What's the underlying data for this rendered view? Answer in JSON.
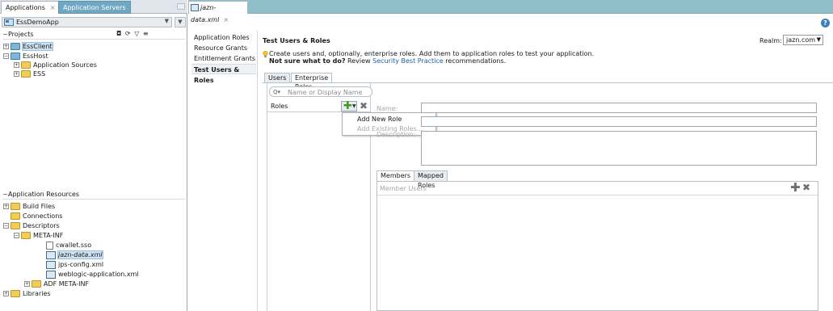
{
  "left_panel": {
    "tabs": [
      {
        "label": "Applications",
        "active": true
      },
      {
        "label": "Application Servers",
        "active": false
      }
    ],
    "app_selector": {
      "value": "EssDemoApp"
    },
    "projects": {
      "header": "Projects",
      "toolbar_icons": [
        "filter-icon",
        "sync-icon",
        "funnel-icon",
        "menu-icon"
      ],
      "items": [
        {
          "label": "EssClient",
          "level": 0,
          "expanded": false,
          "selected": true
        },
        {
          "label": "EssHost",
          "level": 0,
          "expanded": true,
          "selected": false
        },
        {
          "label": "Application Sources",
          "level": 1,
          "expanded": false,
          "selected": false
        },
        {
          "label": "ESS",
          "level": 1,
          "expanded": false,
          "selected": false
        }
      ]
    },
    "resources": {
      "header": "Application Resources",
      "items": [
        {
          "label": "Build Files",
          "level": 0
        },
        {
          "label": "Connections",
          "level": 0
        },
        {
          "label": "Descriptors",
          "level": 0
        },
        {
          "label": "META-INF",
          "level": 1
        },
        {
          "label": "cwallet.sso",
          "level": 2
        },
        {
          "label": "jazn-data.xml",
          "level": 2
        },
        {
          "label": "jps-config.xml",
          "level": 2
        },
        {
          "label": "weblogic-application.xml",
          "level": 2
        },
        {
          "label": "ADF META-INF",
          "level": 1
        },
        {
          "label": "Libraries",
          "level": 0
        }
      ]
    }
  },
  "editor": {
    "tab_label": "jazn-data.xml",
    "nav": {
      "items": [
        "Application Roles",
        "Resource Grants",
        "Entitlement Grants",
        "Test Users & Roles"
      ],
      "active_index": 3
    },
    "title": "Test Users & Roles",
    "realm_label": "Realm:",
    "realm_value": "jazn.com",
    "description": "Create users and, optionally, enterprise roles. Add them to application roles to test your application.",
    "hint_bold": "Not sure what to do?",
    "hint_text": "Review",
    "hint_link": "Security Best Practice",
    "hint_suffix": "recommendations.",
    "subtabs": [
      {
        "label": "Users",
        "active": false
      },
      {
        "label": "Enterprise Roles",
        "active": true
      }
    ],
    "search_placeholder": "Name or Display Name",
    "roles_header": "Roles",
    "add_menu": {
      "items": [
        {
          "label": "Add New Role",
          "enabled": true
        },
        {
          "label": "Add Existing Roles...",
          "enabled": false
        }
      ]
    },
    "form": {
      "name_label": "Name:",
      "description_label": "Description:"
    },
    "member_tabs": [
      {
        "label": "Members",
        "active": true
      },
      {
        "label": "Mapped Roles",
        "active": false
      }
    ],
    "members_header": "Member Users"
  },
  "colors": {
    "accent": "#3c7ebf",
    "link": "#1c5fa8",
    "add_green": "#3d9b1e",
    "tab_bar": "#8fc0c9"
  }
}
